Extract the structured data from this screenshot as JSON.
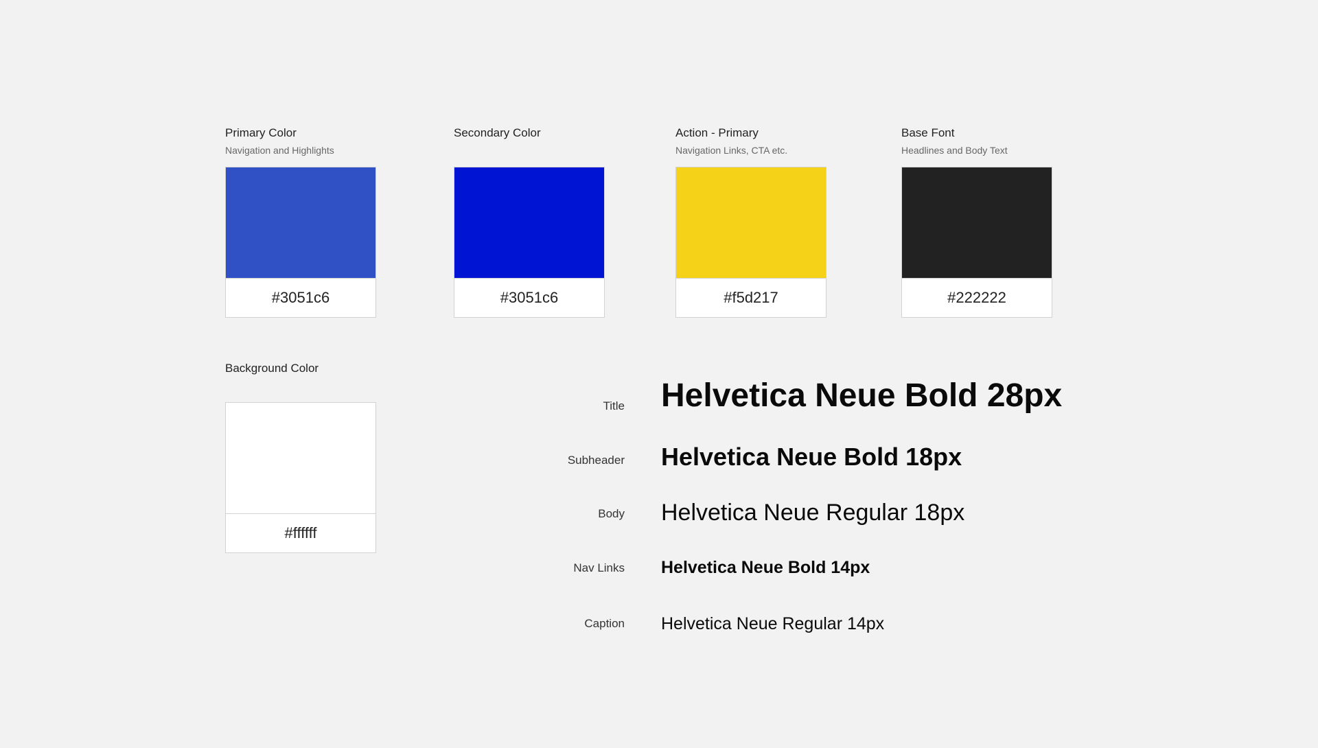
{
  "swatches": [
    {
      "title": "Primary Color",
      "subtitle": "Navigation and Highlights",
      "hex": "#3051c6",
      "color": "#3051c6"
    },
    {
      "title": "Secondary Color",
      "subtitle": "",
      "hex": "#3051c6",
      "color": "#0015d4"
    },
    {
      "title": "Action - Primary",
      "subtitle": "Navigation Links, CTA etc.",
      "hex": "#f5d217",
      "color": "#f5d217"
    },
    {
      "title": "Base Font",
      "subtitle": "Headlines and Body Text",
      "hex": "#222222",
      "color": "#222222"
    },
    {
      "title": "Background Color",
      "subtitle": "",
      "hex": "#ffffff",
      "color": "#ffffff"
    }
  ],
  "typography": [
    {
      "label": "Title",
      "sample": "Helvetica Neue Bold 28px"
    },
    {
      "label": "Subheader",
      "sample": "Helvetica Neue Bold 18px"
    },
    {
      "label": "Body",
      "sample": "Helvetica Neue Regular 18px"
    },
    {
      "label": "Nav Links",
      "sample": "Helvetica Neue Bold 14px"
    },
    {
      "label": "Caption",
      "sample": "Helvetica Neue Regular 14px"
    }
  ]
}
